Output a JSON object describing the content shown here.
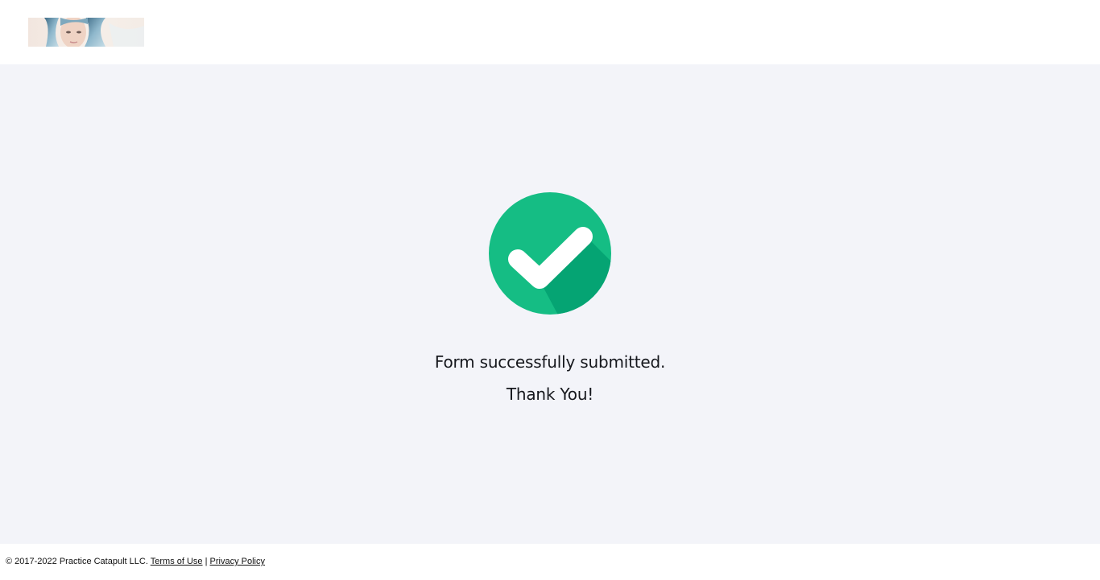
{
  "header": {
    "logo_alt": "portrait-logo"
  },
  "confirmation": {
    "icon": "check-circle-icon",
    "line1": "Form successfully submitted.",
    "line2": "Thank You!"
  },
  "footer": {
    "copyright": "© 2017-2022 Practice Catapult LLC.",
    "terms_label": "Terms of Use",
    "separator": "|",
    "privacy_label": "Privacy Policy"
  },
  "colors": {
    "check_primary": "#15bd84",
    "check_shadow": "#05a473",
    "page_background": "#f3f4f9"
  }
}
